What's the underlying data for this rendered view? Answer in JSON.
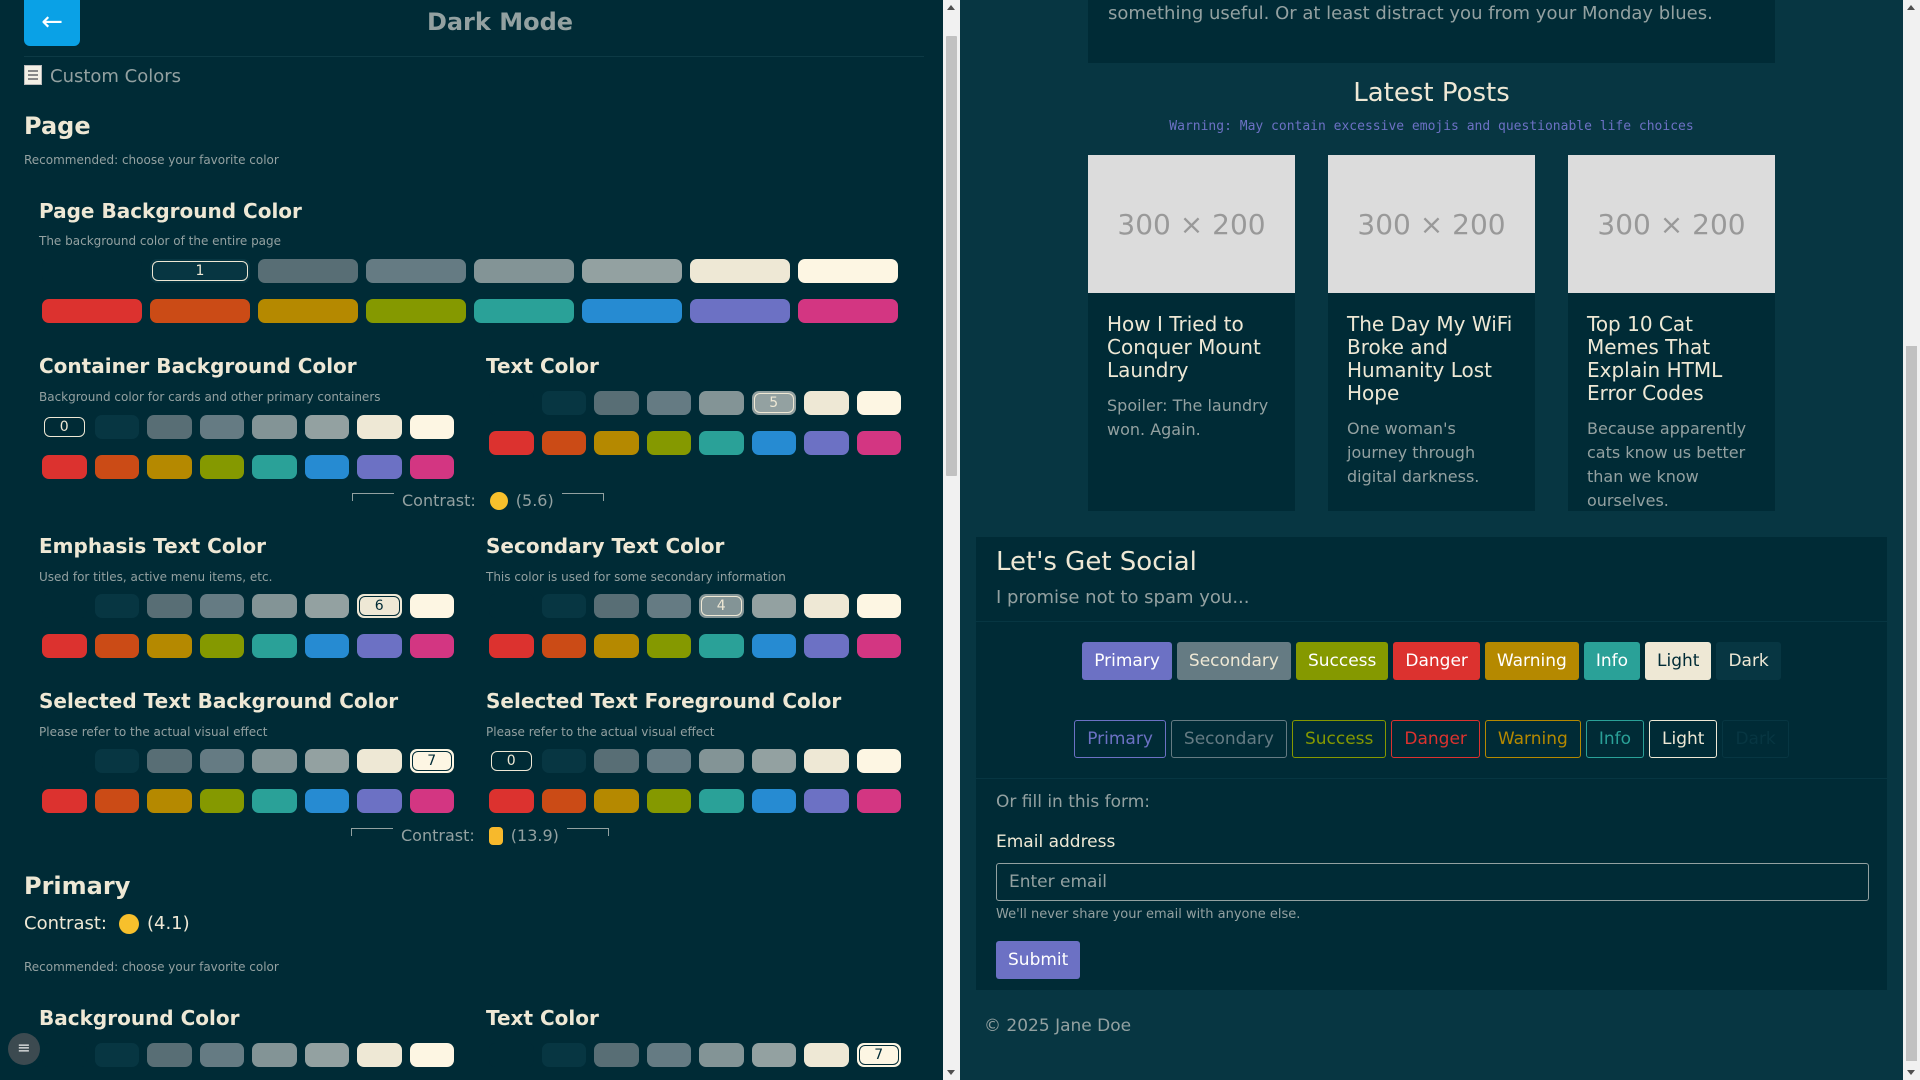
{
  "app": {
    "title": "Dark Mode",
    "back_icon": "←",
    "custom_colors": "Custom Colors"
  },
  "palette": {
    "neutral": [
      "#002b36",
      "#073642",
      "#586e75",
      "#657b83",
      "#839496",
      "#93a1a1",
      "#eee8d5",
      "#fdf6e3"
    ],
    "accent": [
      "#dc322f",
      "#cb4b16",
      "#b58900",
      "#859900",
      "#2aa198",
      "#268bd2",
      "#6c71c4",
      "#d33682"
    ]
  },
  "page_section": {
    "title": "Page",
    "recommend": "Recommended: choose your favorite color",
    "bg": {
      "title": "Page Background Color",
      "desc": "The background color of the entire page",
      "selected": "1"
    },
    "container": {
      "title": "Container Background Color",
      "desc": "Background color for cards and other primary containers",
      "selected": "0"
    },
    "text": {
      "title": "Text Color",
      "selected": "5"
    },
    "contrast1": {
      "label": "Contrast:",
      "value": "(5.6)"
    },
    "emphasis": {
      "title": "Emphasis Text Color",
      "desc": "Used for titles, active menu items, etc.",
      "selected": "6"
    },
    "secondary": {
      "title": "Secondary Text Color",
      "desc": "This color is used for some secondary information",
      "selected": "4"
    },
    "sel_bg": {
      "title": "Selected Text Background Color",
      "desc": "Please refer to the actual visual effect",
      "selected": "7"
    },
    "sel_fg": {
      "title": "Selected Text Foreground Color",
      "desc": "Please refer to the actual visual effect",
      "selected": "0"
    },
    "contrast2": {
      "label": "Contrast:",
      "value": "(13.9)"
    }
  },
  "primary_section": {
    "title": "Primary",
    "contrast_label": "Contrast:",
    "contrast_value": "(4.1)",
    "recommend": "Recommended: choose your favorite color",
    "bg_title": "Background Color",
    "text_title": "Text Color",
    "text_selected": "7"
  },
  "fab_icon": "≡",
  "preview": {
    "intro": "something useful. Or at least distract you from your Monday blues.",
    "posts_title": "Latest Posts",
    "posts_warning": "Warning: May contain excessive emojis and questionable life choices",
    "posts": [
      {
        "image": "300 × 200",
        "title": "How I Tried to Conquer Mount Laundry",
        "desc": "Spoiler: The laundry won. Again."
      },
      {
        "image": "300 × 200",
        "title": "The Day My WiFi Broke and Humanity Lost Hope",
        "desc": "One woman's journey through digital darkness."
      },
      {
        "image": "300 × 200",
        "title": "Top 10 Cat Memes That Explain HTML Error Codes",
        "desc": "Because apparently cats know us better than we know ourselves."
      }
    ],
    "social_title": "Let's Get Social",
    "social_sub": "I promise not to spam you...",
    "buttons": [
      "Primary",
      "Secondary",
      "Success",
      "Danger",
      "Warning",
      "Info",
      "Light",
      "Dark"
    ],
    "form_intro": "Or fill in this form:",
    "email_label": "Email address",
    "email_placeholder": "Enter email",
    "email_help": "We'll never share your email with anyone else.",
    "submit": "Submit",
    "footer": "© 2025 Jane Doe"
  }
}
